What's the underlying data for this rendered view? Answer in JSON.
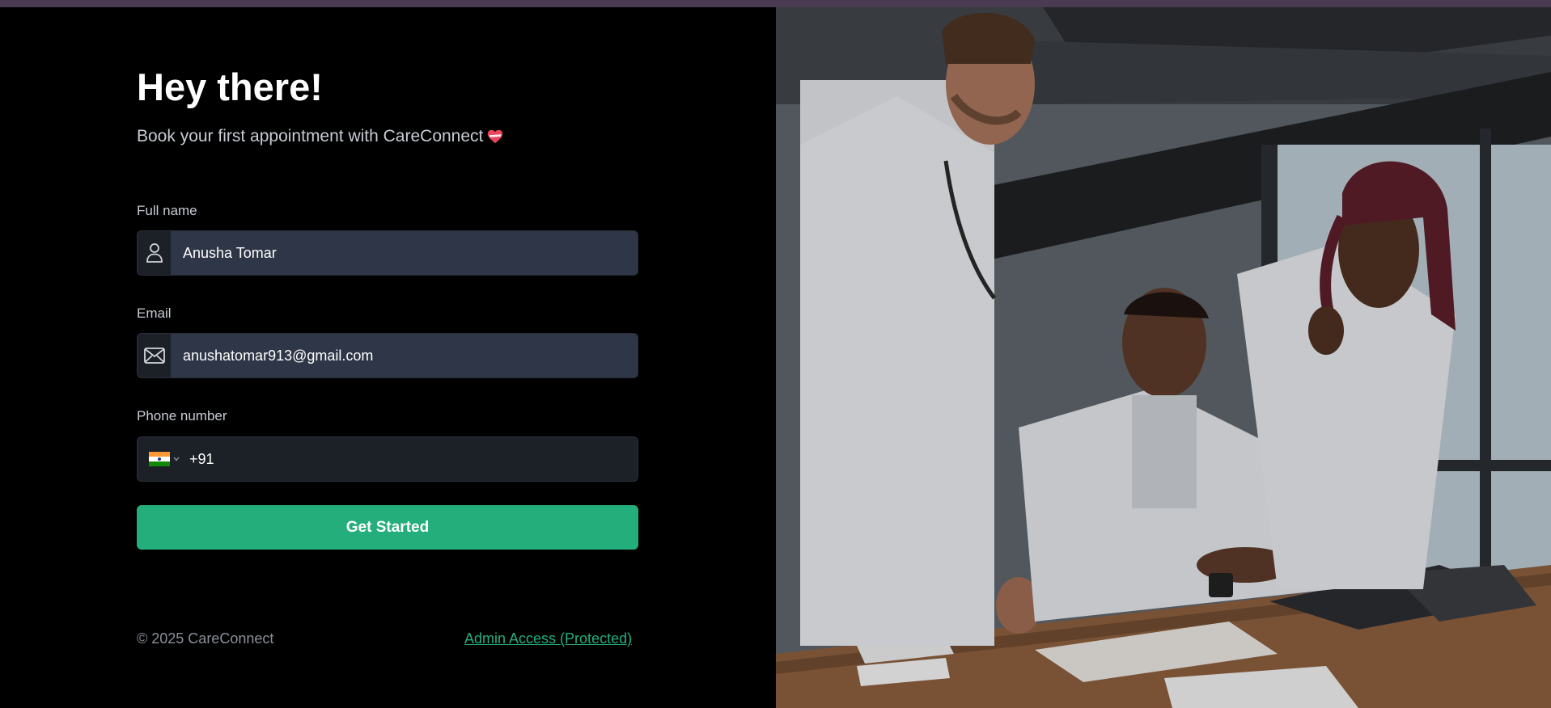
{
  "header": {
    "title": "Hey there!",
    "subtitle": "Book your first appointment with CareConnect"
  },
  "form": {
    "full_name": {
      "label": "Full name",
      "value": "Anusha Tomar",
      "icon": "user-icon"
    },
    "email": {
      "label": "Email",
      "value": "anushatomar913@gmail.com",
      "icon": "mail-icon"
    },
    "phone": {
      "label": "Phone number",
      "country_flag": "india-flag-icon",
      "code": "+91"
    },
    "submit_label": "Get Started"
  },
  "footer": {
    "copyright": "© 2025 CareConnect",
    "admin_link": "Admin Access (Protected)"
  },
  "colors": {
    "accent": "#24ae7c",
    "background": "#000000",
    "input_bg": "#2e3647",
    "topbar": "#4a3a52"
  },
  "image": {
    "subject": "doctors-reviewing-tablet-photo"
  }
}
